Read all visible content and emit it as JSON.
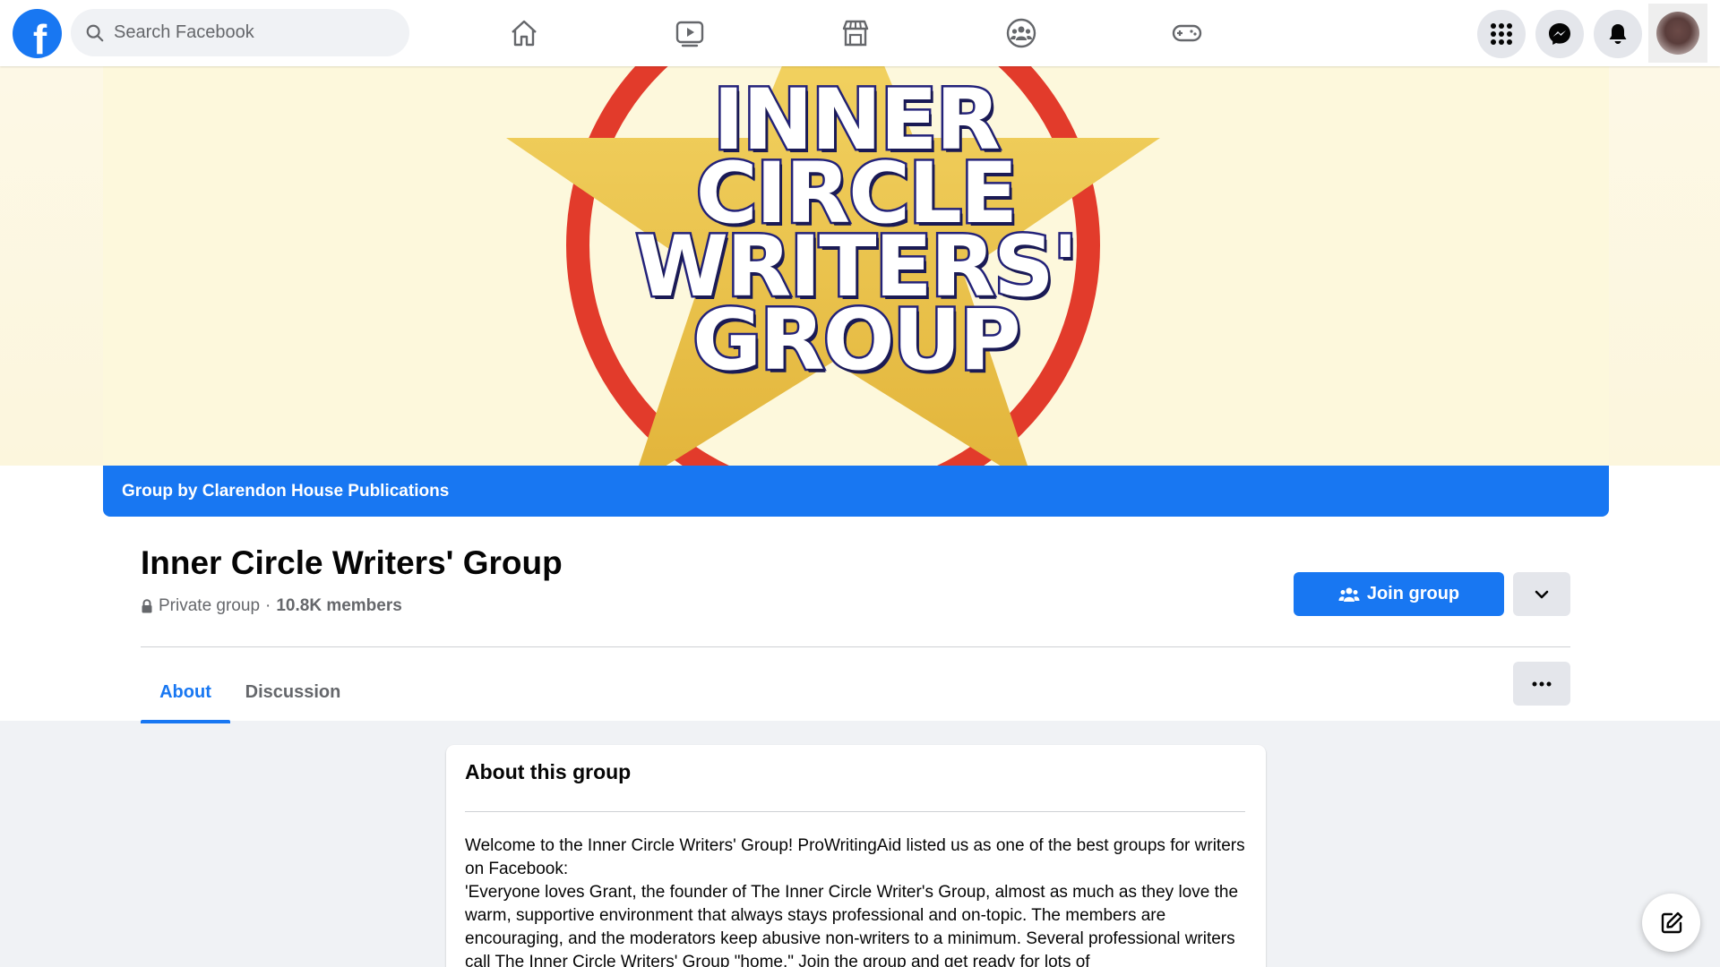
{
  "topbar": {
    "logo_letter": "f",
    "search_placeholder": "Search Facebook",
    "nav_icons": [
      "home-icon",
      "watch-icon",
      "marketplace-icon",
      "groups-icon",
      "gaming-icon"
    ],
    "right_icons": [
      "menu-grid-icon",
      "messenger-icon",
      "notifications-icon"
    ]
  },
  "cover": {
    "title": "INNER\nCIRCLE\nWRITERS'\nGROUP",
    "group_by": "Group by Clarendon House Publications"
  },
  "group": {
    "name": "Inner Circle Writers' Group",
    "privacy": "Private group",
    "separator": "·",
    "members": "10.8K members",
    "join_label": "Join group"
  },
  "tabs": [
    {
      "label": "About",
      "active": true
    },
    {
      "label": "Discussion",
      "active": false
    }
  ],
  "about": {
    "title": "About this group",
    "text_line1": "Welcome to the Inner Circle Writers' Group! ProWritingAid listed us as one of the best groups for writers on Facebook:",
    "text_line2": "'Everyone loves Grant, the founder of The Inner Circle Writer's Group, almost as much as they love the warm, supportive environment that always stays professional and on-topic. The members are encouraging, and the moderators keep abusive non-writers to a minimum. Several professional writers call The Inner Circle Writers' Group \"home.\" Join the group and get ready for lots of"
  },
  "colors": {
    "brand_blue": "#1877f2",
    "background": "#f0f2f5",
    "secondary_text": "#65676b"
  }
}
